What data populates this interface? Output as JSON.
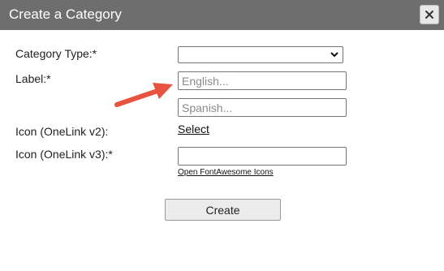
{
  "dialog": {
    "title": "Create a Category",
    "close_icon": "close-icon"
  },
  "form": {
    "category_type_label": "Category Type:*",
    "category_type_value": "",
    "label_label": "Label:*",
    "label_english_placeholder": "English...",
    "label_english_value": "",
    "label_spanish_placeholder": "Spanish...",
    "label_spanish_value": "",
    "icon_v2_label": "Icon (OneLink v2):",
    "icon_v2_select_link": "Select",
    "icon_v3_label": "Icon (OneLink v3):*",
    "icon_v3_value": "",
    "fontawesome_link": "Open FontAwesome Icons",
    "create_button": "Create"
  },
  "annotation": {
    "arrow_icon": "arrow-icon",
    "arrow_color": "#e8533f"
  },
  "colors": {
    "titlebar": "#6e6e6e",
    "title_text": "#ffffff"
  }
}
